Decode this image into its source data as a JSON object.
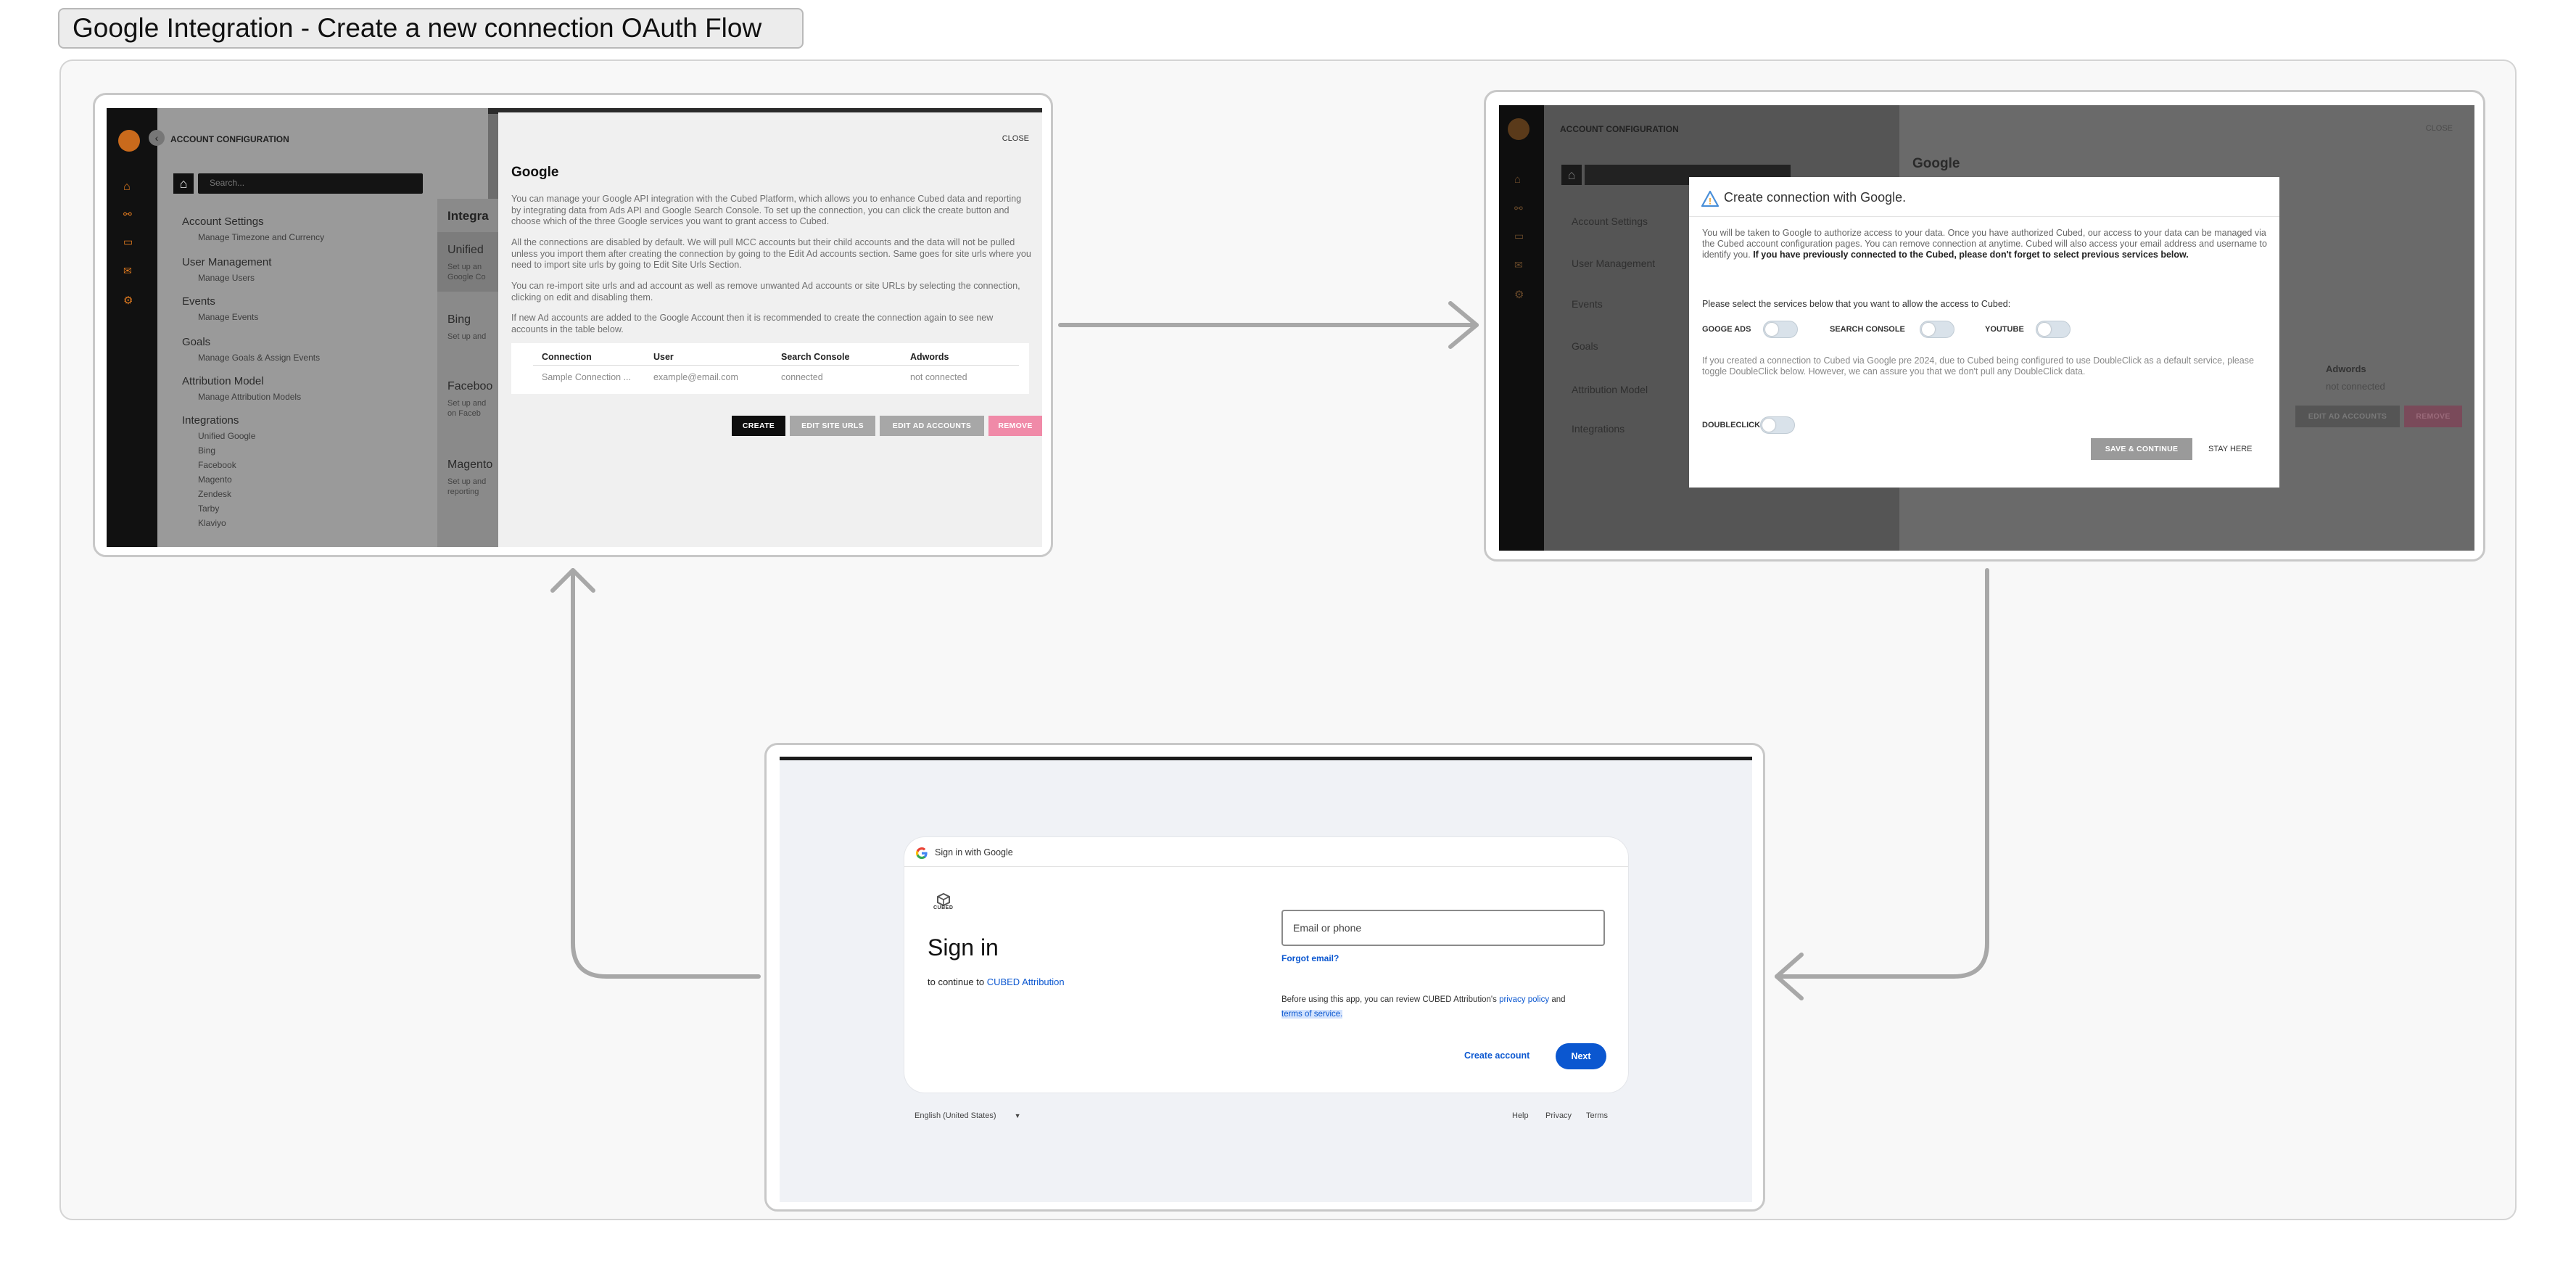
{
  "board": {
    "title": "Google Integration - Create a new connection OAuth Flow"
  },
  "screen1": {
    "sidebar_title": "ACCOUNT CONFIGURATION",
    "search_placeholder": "Search...",
    "menu": [
      {
        "heading": "Account Settings",
        "items": [
          "Manage Timezone and Currency"
        ]
      },
      {
        "heading": "User Management",
        "items": [
          "Manage Users"
        ]
      },
      {
        "heading": "Events",
        "items": [
          "Manage Events"
        ]
      },
      {
        "heading": "Goals",
        "items": [
          "Manage Goals & Assign Events"
        ]
      },
      {
        "heading": "Attribution Model",
        "items": [
          "Manage Attribution Models"
        ]
      },
      {
        "heading": "Integrations",
        "items": [
          "Unified Google",
          "Bing",
          "Facebook",
          "Magento",
          "Zendesk",
          "Tarby",
          "Klaviyo"
        ]
      }
    ],
    "mid": {
      "heading": "Integra",
      "cards": [
        {
          "title": "Unified",
          "desc1": "Set up an",
          "desc2": "Google Co"
        },
        {
          "title": "Bing",
          "desc1": "Set up and",
          "desc2": ""
        },
        {
          "title": "Faceboo",
          "desc1": "Set up and",
          "desc2": "on Faceb"
        },
        {
          "title": "Magento",
          "desc1": "Set up and",
          "desc2": "reporting"
        }
      ]
    },
    "drawer": {
      "close": "CLOSE",
      "title": "Google",
      "p1": "You can manage your Google API integration with the Cubed Platform, which allows you to enhance Cubed data and reporting by integrating data from Ads API and Google Search Console. To set up the connection, you can click the create button and choose which of the three Google services you want to grant access to Cubed.",
      "p2": "All the connections are disabled by default. We will pull MCC accounts but their child accounts and the data will not be pulled unless you import them after creating the connection by going to the Edit Ad accounts section. Same goes for site urls where you need to import site urls by going to Edit Site Urls Section.",
      "p3": "You can re-import site urls and ad account as well as remove unwanted Ad accounts or site URLs by selecting the connection, clicking on edit and disabling them.",
      "p4": "If new Ad accounts are added to the Google Account then it is recommended to create the connection again to see new accounts in the table below.",
      "table": {
        "headers": [
          "Connection",
          "User",
          "Search Console",
          "Adwords"
        ],
        "row": [
          "Sample Connection ...",
          "example@email.com",
          "connected",
          "not connected"
        ]
      },
      "buttons": {
        "create": "CREATE",
        "edit_site_urls": "EDIT SITE URLS",
        "edit_ad_accounts": "EDIT AD ACCOUNTS",
        "remove": "REMOVE"
      }
    }
  },
  "screen2": {
    "bg_sidebar_title": "ACCOUNT CONFIGURATION",
    "bg_close": "CLOSE",
    "bg_title": "Google",
    "bg_adwords": "Adwords",
    "bg_not_connected": "not connected",
    "bg_edit_ad_accounts": "EDIT AD ACCOUNTS",
    "bg_remove": "REMOVE",
    "bg_menu": [
      "Account Settings",
      "User Management",
      "Events",
      "Goals",
      "Attribution Model",
      "Integrations"
    ],
    "modal": {
      "title": "Create connection with Google.",
      "p1": "You will be taken to Google to authorize access to your data. Once you have authorized Cubed, our access to your data can be managed via the Cubed account configuration pages. You can remove connection at anytime. Cubed will also access your email address and username to identify you.",
      "p1_bold": "If you have previously connected to the Cubed, please don't forget to select previous services below.",
      "select_prompt": "Please select the services below that you want to allow the access to Cubed:",
      "services": [
        "GOOGE ADS",
        "SEARCH CONSOLE",
        "YOUTUBE"
      ],
      "p2": "If you created a connection to Cubed via Google pre 2024, due to Cubed being configured to use DoubleClick as a default service, please toggle DoubleClick below. However, we can assure you that we don't pull any DoubleClick data.",
      "doubleclick": "DOUBLECLICK",
      "save": "SAVE & CONTINUE",
      "stay": "STAY HERE"
    }
  },
  "screen3": {
    "header": "Sign in with Google",
    "logo_text": "CUBED",
    "title": "Sign in",
    "continue_prefix": "to continue to",
    "app_name": "CUBED Attribution",
    "email_placeholder": "Email or phone",
    "forgot": "Forgot email?",
    "privacy_prefix": "Before using this app, you can review CUBED Attribution's",
    "privacy_link": "privacy policy",
    "and": "and",
    "terms_link": "terms of service",
    "period": ".",
    "create_account": "Create account",
    "next": "Next",
    "language": "English (United States)",
    "footer_links": [
      "Help",
      "Privacy",
      "Terms"
    ]
  },
  "colors": {
    "accent_orange": "#e07a1f",
    "google_blue": "#0b57d0",
    "remove_pink": "#f08aa8",
    "warn_blue": "#4a8fd8"
  }
}
